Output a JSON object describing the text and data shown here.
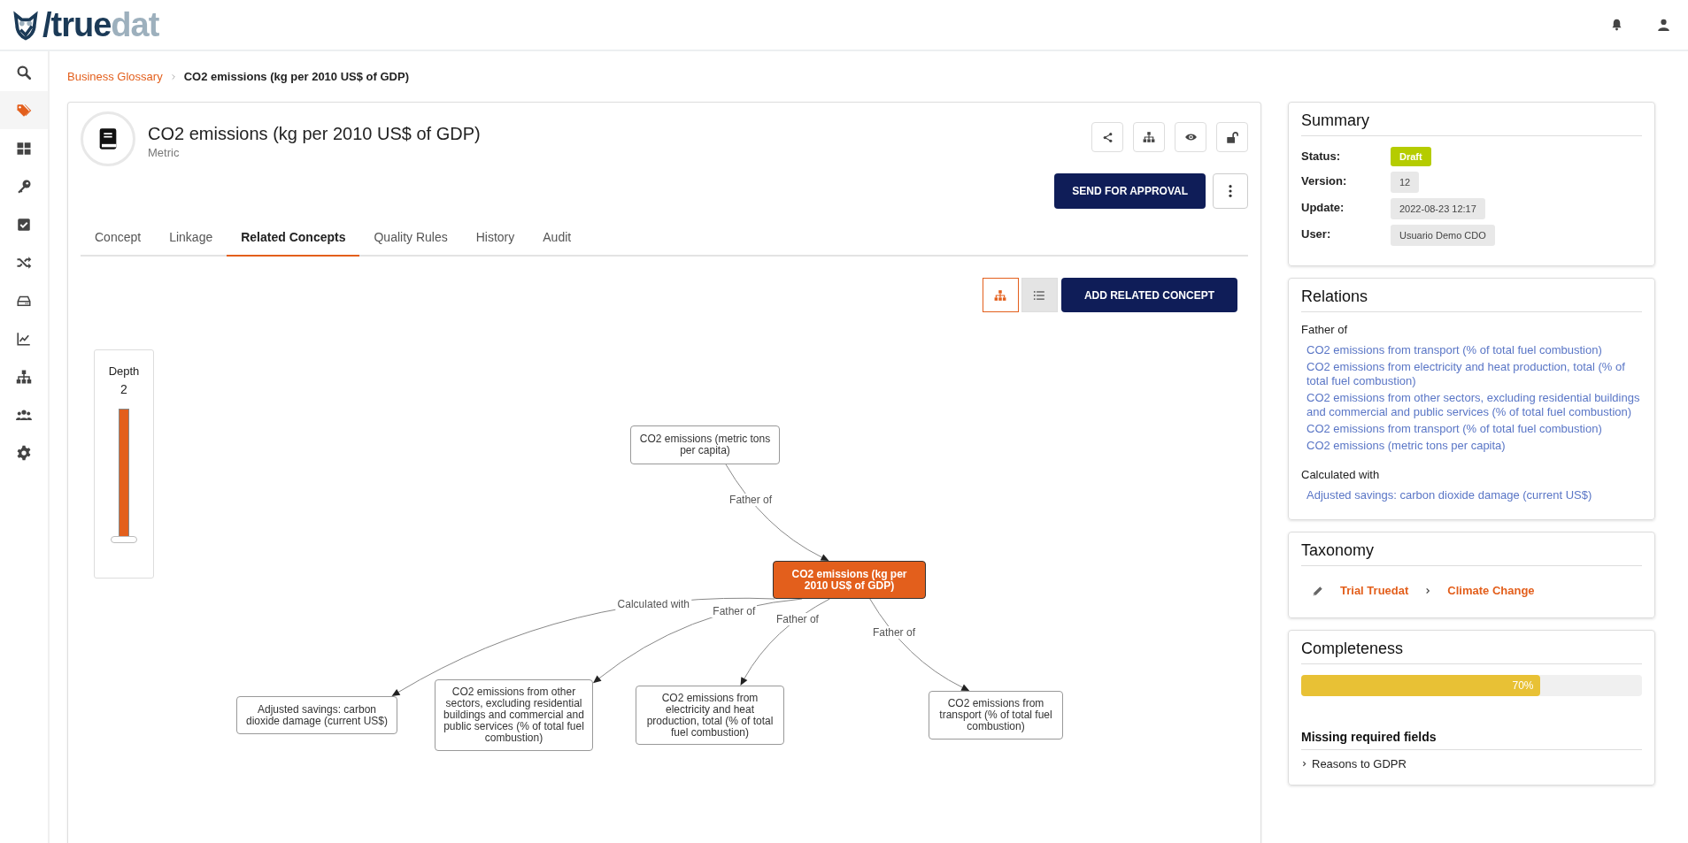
{
  "logo": {
    "slash": "/",
    "primary": "true",
    "secondary": "dat"
  },
  "sidebar": {
    "items": [
      {
        "kind": "search",
        "selected": false
      },
      {
        "kind": "tags",
        "selected": true
      },
      {
        "kind": "dashboard",
        "selected": false
      },
      {
        "kind": "key",
        "selected": false
      },
      {
        "kind": "check",
        "selected": false
      },
      {
        "kind": "shuffle",
        "selected": false
      },
      {
        "kind": "drive",
        "selected": false
      },
      {
        "kind": "chart",
        "selected": false
      },
      {
        "kind": "hierarchy",
        "selected": false
      },
      {
        "kind": "users",
        "selected": false
      },
      {
        "kind": "gear",
        "selected": false
      }
    ]
  },
  "breadcrumb": [
    "Business Glossary",
    "CO2 emissions (kg per 2010 US$ of GDP)"
  ],
  "concept": {
    "title": "CO2 emissions (kg per 2010 US$ of GDP)",
    "type": "Metric"
  },
  "primary_button": "SEND FOR APPROVAL",
  "tabs": [
    {
      "label": "Concept",
      "selected": false
    },
    {
      "label": "Linkage",
      "selected": false
    },
    {
      "label": "Related Concepts",
      "selected": true
    },
    {
      "label": "Quality Rules",
      "selected": false
    },
    {
      "label": "History",
      "selected": false
    },
    {
      "label": "Audit",
      "selected": false
    }
  ],
  "view_toggle": [
    {
      "kind": "graph",
      "selected": true
    },
    {
      "kind": "list",
      "selected": false
    }
  ],
  "add_button": "ADD RELATED CONCEPT",
  "depth": {
    "label": "Depth",
    "value": "2",
    "level": 1
  },
  "graph": {
    "nodes": [
      {
        "label": "CO2 emissions (metric tons per capita)",
        "current": false
      },
      {
        "label": "CO2 emissions (kg per 2010 US$ of GDP)",
        "current": true
      },
      {
        "label": "Adjusted savings: carbon dioxide damage (current US$)",
        "current": false
      },
      {
        "label": "CO2 emissions from other sectors, excluding residential buildings and commercial and public services (% of total fuel combustion)",
        "current": false
      },
      {
        "label": "CO2 emissions from electricity and heat production, total (% of total fuel combustion)",
        "current": false
      },
      {
        "label": "CO2 emissions from transport (% of total fuel combustion)",
        "current": false
      }
    ],
    "edges": [
      {
        "label": "Father of"
      },
      {
        "label": "Calculated with"
      },
      {
        "label": "Father of"
      },
      {
        "label": "Father of"
      },
      {
        "label": "Father of"
      }
    ]
  },
  "summary": {
    "title": "Summary",
    "rows": [
      {
        "label": "Status:",
        "value": "Draft",
        "kind": "status"
      },
      {
        "label": "Version:",
        "value": "12",
        "kind": "plain"
      },
      {
        "label": "Update:",
        "value": "2022-08-23 12:17",
        "kind": "plain"
      },
      {
        "label": "User:",
        "value": "Usuario Demo CDO",
        "kind": "plain"
      }
    ]
  },
  "relations": {
    "title": "Relations",
    "groups": [
      {
        "label": "Father of",
        "items": [
          "CO2 emissions from transport (% of total fuel combustion)",
          "CO2 emissions from electricity and heat production, total (% of total fuel combustion)",
          "CO2 emissions from other sectors, excluding residential buildings and commercial and public services (% of total fuel combustion)",
          "CO2 emissions from transport (% of total fuel combustion)",
          "CO2 emissions (metric tons per capita)"
        ]
      },
      {
        "label": "Calculated with",
        "items": [
          "Adjusted savings: carbon dioxide damage (current US$)"
        ]
      }
    ]
  },
  "taxonomy": {
    "title": "Taxonomy",
    "path": [
      "Trial Truedat",
      "Climate Change"
    ]
  },
  "completeness": {
    "title": "Completeness",
    "level": 0.7,
    "reading": "70%",
    "missing_title": "Missing required fields",
    "missing_items": [
      "Reasons to GDPR"
    ]
  }
}
